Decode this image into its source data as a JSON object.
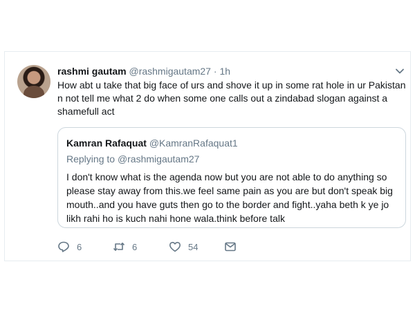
{
  "tweet": {
    "display_name": "rashmi gautam",
    "handle": "@rashmigautam27",
    "separator": "·",
    "time": "1h",
    "text_lines": [
      "How abt u take that big face of urs and shove it up in some rat hole in ur Pakistan",
      "n not tell me what 2 do when some one calls out a zindabad slogan against a",
      "shamefull act"
    ]
  },
  "quote": {
    "display_name": "Kamran Rafaquat",
    "handle": "@KamranRafaquat1",
    "replying_prefix": "Replying to ",
    "replying_handle": "@rashmigautam27",
    "text_lines": [
      "I don't know what is the agenda now but you are not able to do anything so",
      "please stay away from this.we feel same pain as you are but don't speak big",
      "mouth..and you have guts then go to the border and fight..yaha beth k ye jo",
      "likh rahi ho is kuch nahi hone wala.think before talk"
    ]
  },
  "actions": {
    "reply_count": "6",
    "retweet_count": "6",
    "like_count": "54",
    "icons": [
      "reply-icon",
      "retweet-icon",
      "like-icon",
      "message-icon"
    ]
  },
  "colors": {
    "text": "#14171a",
    "muted": "#657786",
    "link": "#1da1f2",
    "border": "#e6ecf0"
  }
}
